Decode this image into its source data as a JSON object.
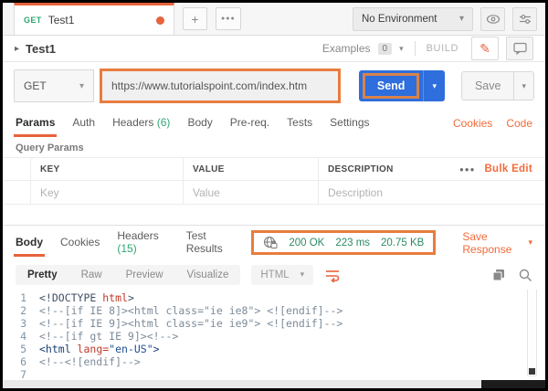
{
  "colors": {
    "accent_orange": "#f26b3a",
    "annotation_orange": "#e87c3e",
    "send_blue": "#2e6edd",
    "count_green": "#2ea873",
    "status_green": "#2d8a64"
  },
  "icons": {
    "chevron_down": "▾",
    "caret_right": "▸",
    "plus": "+",
    "more_horizontal": "●●●",
    "pencil": "✎"
  },
  "header": {
    "tab": {
      "method": "GET",
      "name": "Test1"
    },
    "environment_selector": "No Environment"
  },
  "request_header": {
    "title": "Test1",
    "examples_label": "Examples",
    "examples_count": "0",
    "build_label": "BUILD"
  },
  "request_bar": {
    "method": "GET",
    "url": "https://www.tutorialspoint.com/index.htm",
    "send_label": "Send",
    "save_label": "Save"
  },
  "request_tabs": {
    "items": [
      {
        "label": "Params"
      },
      {
        "label": "Auth"
      },
      {
        "label": "Headers",
        "count": "(6)"
      },
      {
        "label": "Body"
      },
      {
        "label": "Pre-req."
      },
      {
        "label": "Tests"
      },
      {
        "label": "Settings"
      }
    ],
    "cookies_label": "Cookies",
    "code_label": "Code"
  },
  "query_params": {
    "section_title": "Query Params",
    "columns": [
      "KEY",
      "VALUE",
      "DESCRIPTION"
    ],
    "bulk_edit_label": "Bulk Edit",
    "row_placeholders": [
      "Key",
      "Value",
      "Description"
    ]
  },
  "response": {
    "tabs": [
      {
        "label": "Body"
      },
      {
        "label": "Cookies"
      },
      {
        "label": "Headers",
        "count": "(15)"
      },
      {
        "label": "Test Results"
      }
    ],
    "status": {
      "code": "200 OK",
      "time": "223 ms",
      "size": "20.75 KB"
    },
    "save_response_label": "Save Response",
    "view_tabs": [
      "Pretty",
      "Raw",
      "Preview",
      "Visualize"
    ],
    "format_selector": "HTML"
  },
  "code": {
    "lines": [
      {
        "n": "1",
        "tokens": [
          [
            "d",
            "<!DOCTYPE "
          ],
          [
            "r",
            "html"
          ],
          [
            "d",
            ">"
          ]
        ]
      },
      {
        "n": "2",
        "tokens": [
          [
            "c",
            "<!--[if IE 8]><html class=\"ie ie8\"> <![endif]-->"
          ]
        ]
      },
      {
        "n": "3",
        "tokens": [
          [
            "c",
            "<!--[if IE 9]><html class=\"ie ie9\"> <![endif]-->"
          ]
        ]
      },
      {
        "n": "4",
        "tokens": [
          [
            "c",
            "<!--[if gt IE 9]><!-->"
          ]
        ]
      },
      {
        "n": "5",
        "tokens": [
          [
            "t",
            "<html "
          ],
          [
            "r",
            "lang="
          ],
          [
            "s",
            "\"en-US\""
          ],
          [
            "t",
            ">"
          ]
        ]
      },
      {
        "n": "6",
        "tokens": [
          [
            "c",
            "<!--<![endif]-->"
          ]
        ]
      },
      {
        "n": "7",
        "tokens": []
      }
    ]
  }
}
